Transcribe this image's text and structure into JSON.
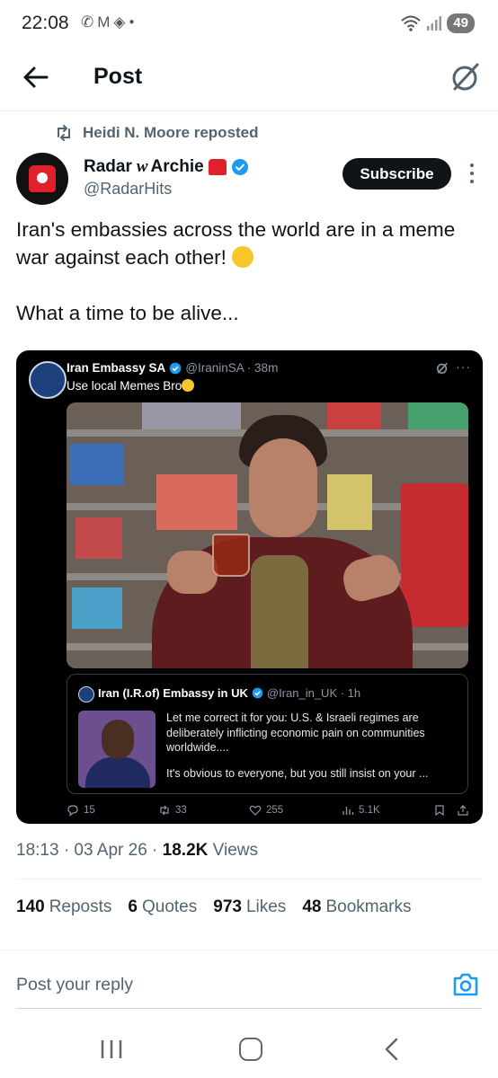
{
  "status_bar": {
    "time": "22:08",
    "battery": "49",
    "left_icons": [
      "whatsapp-icon",
      "gmail-icon",
      "layers-icon",
      "dot-icon"
    ],
    "right_icons": [
      "wifi-icon",
      "signal-icon"
    ]
  },
  "header": {
    "title": "Post"
  },
  "repost": {
    "text": "Heidi N. Moore reposted"
  },
  "author": {
    "name": "Radar",
    "name_suffix": "w",
    "name_end": "Archie",
    "handle": "@RadarHits",
    "subscribe_label": "Subscribe"
  },
  "post": {
    "line1": "Iran's embassies across the world are in a meme war against each other!",
    "line2": "What a time to be alive..."
  },
  "embedded_post": {
    "name": "Iran Embassy SA",
    "handle_time": "@IraninSA · 38m",
    "text": "Use local Memes Bro",
    "quote": {
      "name": "Iran (I.R.of) Embassy in UK",
      "handle_time": "@Iran_in_UK · 1h",
      "text1": "Let me correct it for you: U.S. & Israeli regimes are deliberately inflicting economic pain on communities worldwide....",
      "text2": "It's obvious to everyone, but you still insist on your ..."
    },
    "actions": {
      "replies": "15",
      "reposts": "33",
      "likes": "255",
      "views": "5.1K"
    }
  },
  "meta": {
    "time_date": "18:13 · 03 Apr 26 · ",
    "views_count": "18.2K",
    "views_label": " Views"
  },
  "stats": {
    "reposts_count": "140",
    "reposts_label": "Reposts",
    "quotes_count": "6",
    "quotes_label": "Quotes",
    "likes_count": "973",
    "likes_label": "Likes",
    "bookmarks_count": "48",
    "bookmarks_label": "Bookmarks"
  },
  "reply": {
    "placeholder": "Post your reply"
  },
  "colors": {
    "accent": "#1d9bf0",
    "text": "#0f1419",
    "secondary": "#536471"
  }
}
